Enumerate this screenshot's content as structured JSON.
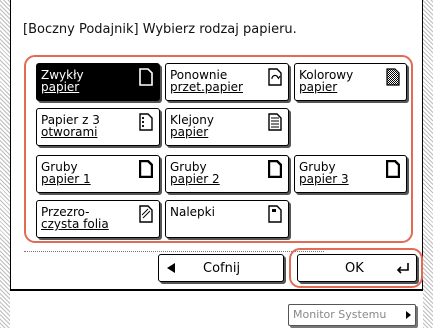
{
  "header": {
    "title": "[Boczny Podajnik] Wybierz rodzaj papieru."
  },
  "paper_types": [
    {
      "line1": "Zwykły",
      "line2": "papier",
      "icon": "plain-paper-icon",
      "selected": true
    },
    {
      "line1": "Ponownie",
      "line2": "przet.papier",
      "icon": "recycled-paper-icon",
      "selected": false
    },
    {
      "line1": "Kolorowy",
      "line2": "papier",
      "icon": "color-paper-icon",
      "selected": false
    },
    {
      "line1": "Papier z 3",
      "line2": "otworami",
      "icon": "three-hole-paper-icon",
      "selected": false
    },
    {
      "line1": "Klejony",
      "line2": "papier",
      "icon": "bond-paper-icon",
      "selected": false
    },
    {
      "line1": "Gruby",
      "line2": "papier 1",
      "icon": "heavy-paper-icon",
      "selected": false
    },
    {
      "line1": "Gruby",
      "line2": "papier 2",
      "icon": "heavy-paper-icon",
      "selected": false
    },
    {
      "line1": "Gruby",
      "line2": "papier 3",
      "icon": "heavy-paper-icon",
      "selected": false
    },
    {
      "line1": "Przezro-",
      "line2": "czysta folia",
      "icon": "transparency-icon",
      "selected": false
    },
    {
      "line1": "Nalepki",
      "line2": "",
      "icon": "labels-icon",
      "selected": false
    }
  ],
  "footer": {
    "back_label": "Cofnij",
    "ok_label": "OK",
    "monitor_label": "Monitor Systemu"
  },
  "colors": {
    "highlight": "#e36b54",
    "selected_bg": "#000000"
  }
}
